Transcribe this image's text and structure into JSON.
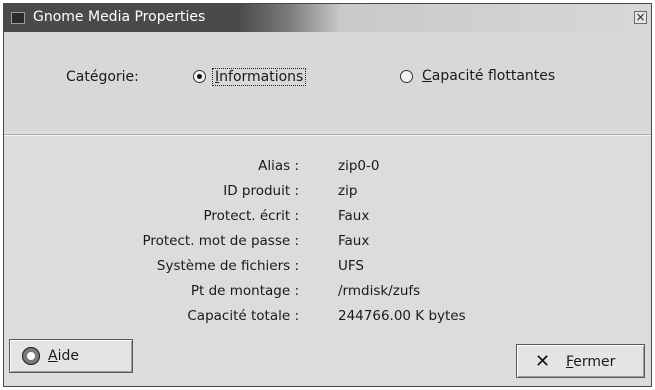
{
  "window": {
    "title": "Gnome Media Properties"
  },
  "category": {
    "label": "Catégorie:",
    "options": [
      {
        "label": "Informations",
        "selected": true
      },
      {
        "label": "Capacité flottantes",
        "selected": false
      }
    ]
  },
  "info_rows": [
    {
      "key": "Alias :",
      "value": "zip0-0"
    },
    {
      "key": "ID produit :",
      "value": "zip"
    },
    {
      "key": "Protect. écrit :",
      "value": "Faux"
    },
    {
      "key": "Protect. mot de passe :",
      "value": "Faux"
    },
    {
      "key": "Système de fichiers :",
      "value": "UFS"
    },
    {
      "key": "Pt de montage :",
      "value": "/rmdisk/zufs"
    },
    {
      "key": "Capacité totale :",
      "value": "244766.00 K bytes"
    }
  ],
  "buttons": {
    "help_label": "Aide",
    "close_label": "Fermer"
  },
  "icons": {
    "window": "window-menu-icon",
    "close": "close-icon",
    "help": "lifebuoy-help-icon",
    "fermer": "x-close-icon"
  }
}
